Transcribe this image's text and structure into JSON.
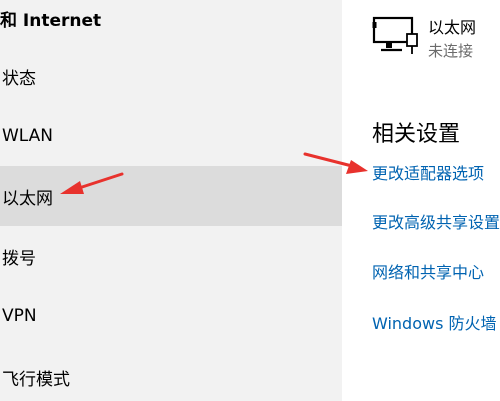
{
  "sidebar": {
    "header": "和 Internet",
    "items": [
      {
        "label": "状态"
      },
      {
        "label": "WLAN"
      },
      {
        "label": "以太网",
        "selected": true
      },
      {
        "label": "拨号"
      },
      {
        "label": "VPN"
      },
      {
        "label": "飞行模式"
      }
    ]
  },
  "content": {
    "network": {
      "icon": "ethernet-monitor-icon",
      "name": "以太网",
      "status": "未连接"
    },
    "related_settings": {
      "title": "相关设置",
      "links": [
        {
          "label": "更改适配器选项"
        },
        {
          "label": "更改高级共享设置"
        },
        {
          "label": "网络和共享中心"
        },
        {
          "label": "Windows 防火墙"
        }
      ]
    }
  },
  "annotations": {
    "arrow_color": "#e8322d"
  },
  "colors": {
    "sidebar_bg": "#f2f2f2",
    "selected_bg": "#dcdcdc",
    "link": "#0063b1"
  }
}
